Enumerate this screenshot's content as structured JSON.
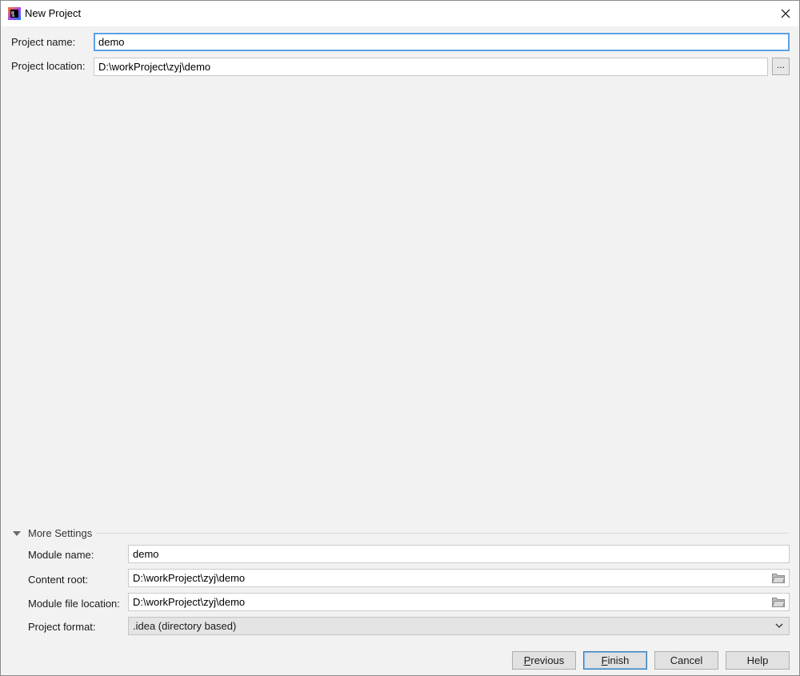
{
  "window": {
    "title": "New Project",
    "app_icon": "intellij-idea-icon",
    "close_icon": "close-icon"
  },
  "project": {
    "name_label": "Project name:",
    "name_value": "demo",
    "location_label": "Project location:",
    "location_value": "D:\\workProject\\zyj\\demo",
    "browse_label": "..."
  },
  "more_settings": {
    "header": "More Settings",
    "expanded": true,
    "module_name_label": "Module name:",
    "module_name_value": "demo",
    "content_root_label": "Content root:",
    "content_root_value": "D:\\workProject\\zyj\\demo",
    "module_file_label": "Module file location:",
    "module_file_value": "D:\\workProject\\zyj\\demo",
    "format_label": "Project format:",
    "format_value": ".idea (directory based)"
  },
  "buttons": {
    "previous": {
      "mnemonic": "P",
      "rest": "revious"
    },
    "finish": {
      "mnemonic": "F",
      "rest": "inish"
    },
    "cancel": "Cancel",
    "help": "Help"
  },
  "colors": {
    "focus_border": "#5ea1e6",
    "dialog_bg": "#f2f2f2",
    "default_button_border": "#3c7fb1"
  }
}
